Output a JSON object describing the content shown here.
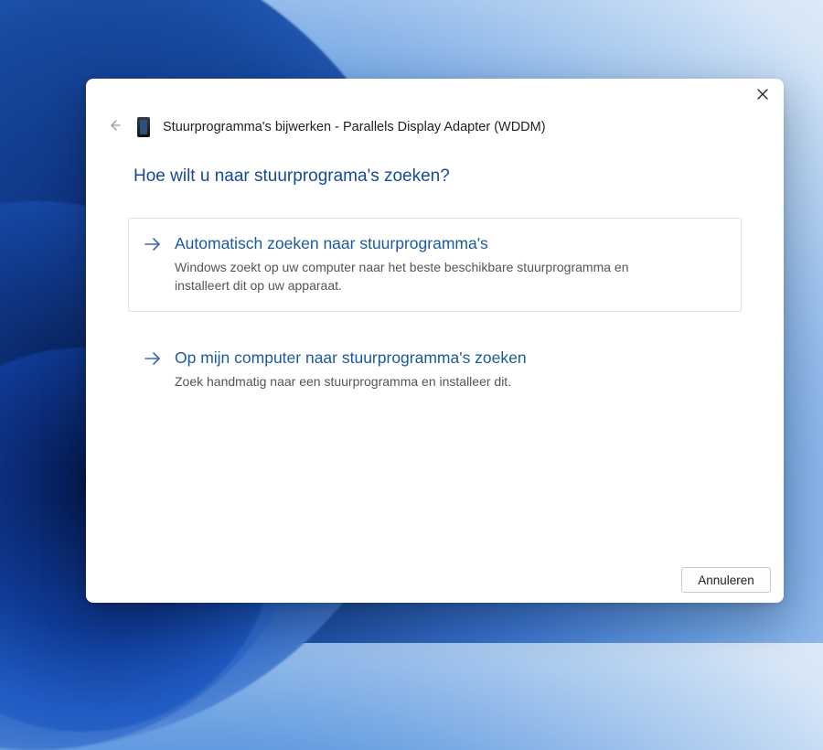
{
  "header": {
    "title": "Stuurprogramma's bijwerken - Parallels Display Adapter (WDDM)"
  },
  "question": "Hoe wilt u naar stuurprograma's zoeken?",
  "options": [
    {
      "title": "Automatisch zoeken naar stuurprogramma's",
      "description": "Windows zoekt op uw computer naar het beste beschikbare stuurprogramma en installeert dit op uw apparaat."
    },
    {
      "title": "Op mijn computer naar stuurprogramma's zoeken",
      "description": "Zoek handmatig naar een stuurprogramma en installeer dit."
    }
  ],
  "buttons": {
    "cancel": "Annuleren"
  }
}
